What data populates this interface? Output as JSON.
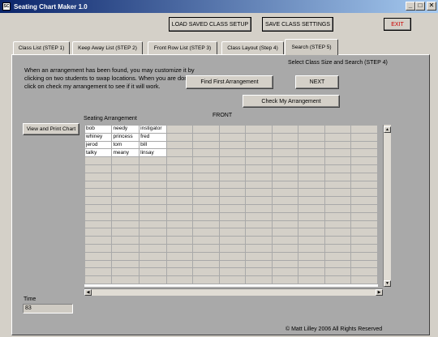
{
  "window": {
    "title": "Seating Chart Maker 1.0",
    "controls": [
      "_",
      "□",
      "✕"
    ]
  },
  "toolbar": {
    "load_label": "LOAD SAVED CLASS SETUP",
    "save_label": "SAVE CLASS SETTINGS",
    "exit_label": "EXIT",
    "exit_color": "#cc0000"
  },
  "tabs": [
    {
      "label": "Class List (STEP 1)"
    },
    {
      "label": "Keep Away List (STEP 2)"
    },
    {
      "label": "Front Row List (STEP 3)"
    },
    {
      "label": "Class Layout (Step 4)"
    },
    {
      "label": "Search (STEP 5)",
      "active": true
    }
  ],
  "search": {
    "instructions": "When an arrangement has been found, you may customize it by clicking on two students to swap locations. When you are done, click on check my arrangement to see if it will work.",
    "select_label": "Select Class Size and Search (STEP 4)",
    "find_first_label": "Find First Arrangement",
    "next_label": "NEXT",
    "check_label": "Check My Arrangement",
    "view_print_label": "View and Print Chart",
    "seating_label": "Seating Arrangement",
    "front_label": "FRONT",
    "time_label": "Time",
    "time_value": "83"
  },
  "seating_grid": {
    "columns": 11,
    "rows": 20,
    "cells": [
      [
        "bob",
        "needy",
        "instigator"
      ],
      [
        "whiney",
        "princess",
        "fred"
      ],
      [
        "jerod",
        "tom",
        "bill"
      ],
      [
        "talky",
        "meany",
        "linsay"
      ]
    ]
  },
  "footer": {
    "copyright": "© Matt Lilley 2006 All Rights Reserved"
  }
}
